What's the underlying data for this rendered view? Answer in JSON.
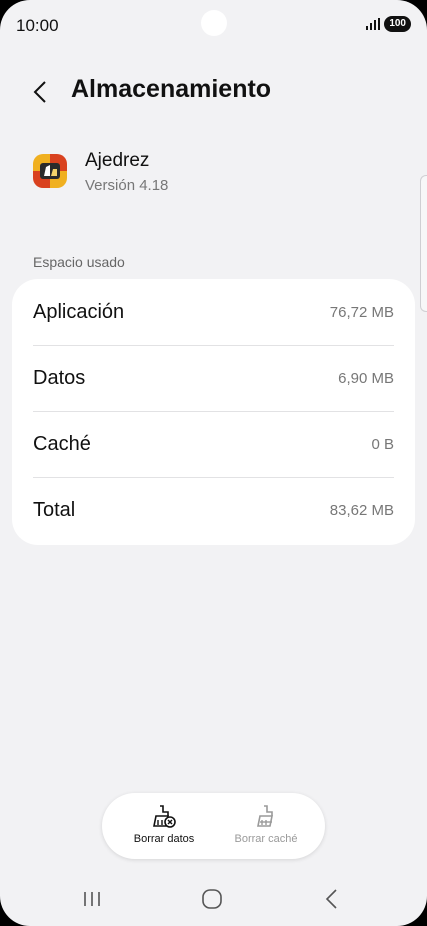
{
  "status_bar": {
    "time": "10:00",
    "battery": "100"
  },
  "header": {
    "title": "Almacenamiento"
  },
  "app": {
    "name": "Ajedrez",
    "version": "Versión 4.18"
  },
  "storage": {
    "section_label": "Espacio usado",
    "rows": [
      {
        "label": "Aplicación",
        "value": "76,72 MB"
      },
      {
        "label": "Datos",
        "value": "6,90 MB"
      },
      {
        "label": "Caché",
        "value": "0 B"
      },
      {
        "label": "Total",
        "value": "83,62 MB"
      }
    ]
  },
  "actions": {
    "clear_data": {
      "label": "Borrar datos",
      "enabled": true
    },
    "clear_cache": {
      "label": "Borrar caché",
      "enabled": false
    }
  },
  "icons": {
    "back": "chevron-left-icon",
    "app": "chess-app-icon",
    "clear_data": "broom-clear-icon",
    "clear_cache": "broom-icon",
    "recents": "recents-icon",
    "home": "home-icon",
    "nav_back": "back-icon"
  }
}
